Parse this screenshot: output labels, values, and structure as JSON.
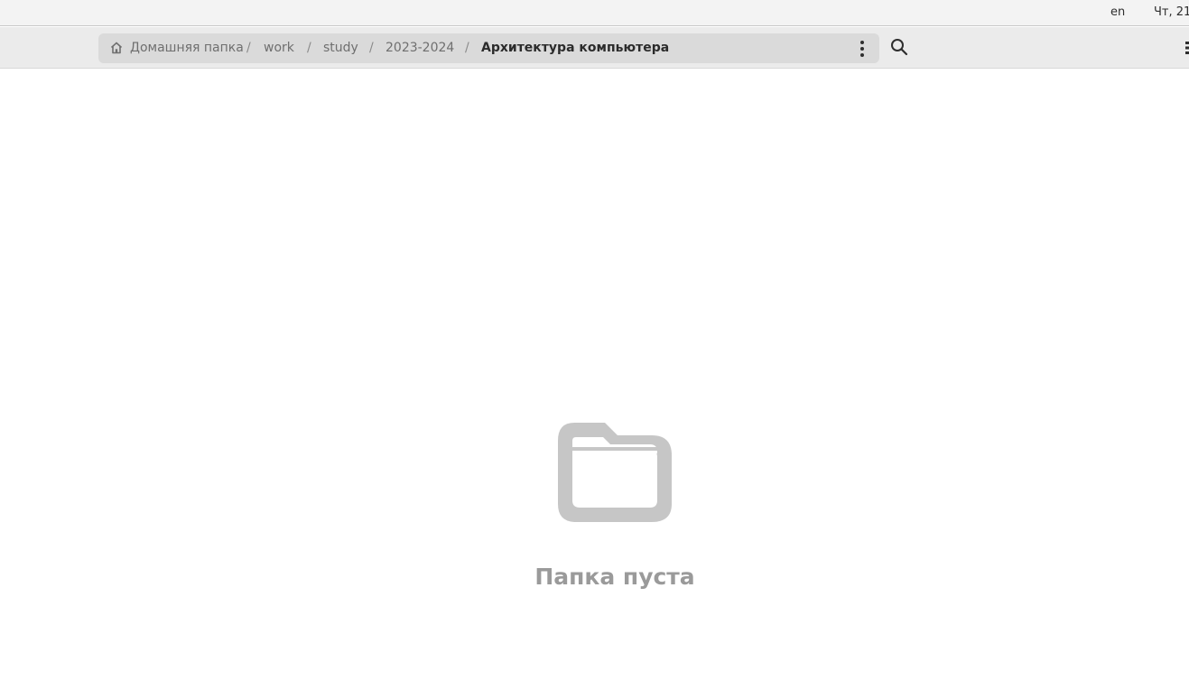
{
  "system_bar": {
    "language": "en",
    "clock": "Чт, 21"
  },
  "pathbar": {
    "crumbs": [
      {
        "label": "Домашняя папка",
        "icon": "home-icon"
      },
      {
        "label": "work"
      },
      {
        "label": "study"
      },
      {
        "label": "2023-2024"
      },
      {
        "label": "Архитектура компьютера",
        "current": true
      }
    ],
    "separator": "/"
  },
  "toolbar": {
    "menu_icon": "vertical-dots-icon",
    "search_icon": "search-icon"
  },
  "empty_state": {
    "icon": "folder-icon",
    "message": "Папка пуста"
  }
}
